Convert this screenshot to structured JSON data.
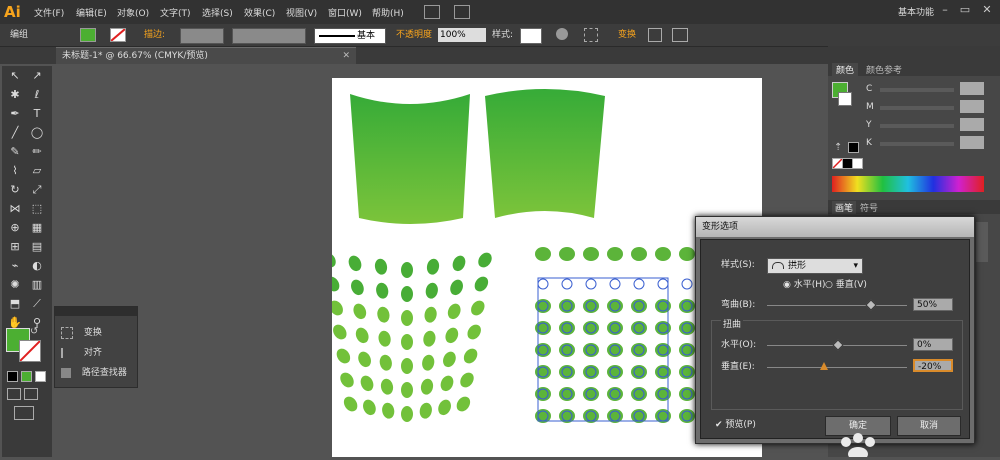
{
  "app": {
    "logo": "Ai",
    "workspace": "基本功能"
  },
  "menu": [
    "文件(F)",
    "编辑(E)",
    "对象(O)",
    "文字(T)",
    "选择(S)",
    "效果(C)",
    "视图(V)",
    "窗口(W)",
    "帮助(H)"
  ],
  "control": {
    "selection_label": "编组",
    "stroke_label": "描边:",
    "stroke_style": "基本",
    "opacity_label": "不透明度",
    "opacity_value": "100%",
    "style_label": "样式:",
    "transform_label": "变换"
  },
  "document": {
    "tab_title": "未标题-1* @ 66.67% (CMYK/预览)"
  },
  "mini_panel": {
    "items": [
      "变换",
      "对齐",
      "路径查找器"
    ]
  },
  "color_panel": {
    "tabs": [
      "颜色",
      "颜色参考"
    ],
    "channels": [
      "C",
      "M",
      "Y",
      "K"
    ],
    "sub_tabs": [
      "画笔",
      "符号"
    ]
  },
  "dialog": {
    "title": "变形选项",
    "style_label": "样式(S):",
    "style_value": "拱形",
    "horizontal_radio": "水平(H)",
    "vertical_radio": "垂直(V)",
    "bend_label": "弯曲(B):",
    "bend_value": "50%",
    "distortion_label": "扭曲",
    "dist_h_label": "水平(O):",
    "dist_h_value": "0%",
    "dist_v_label": "垂直(E):",
    "dist_v_value": "-20%",
    "preview_label": "预览(P)",
    "ok_label": "确定",
    "cancel_label": "取消"
  },
  "colors": {
    "fill_green": "#4caf32",
    "brand": "#f7a41d",
    "dialog_bg": "#3f3f3f"
  }
}
